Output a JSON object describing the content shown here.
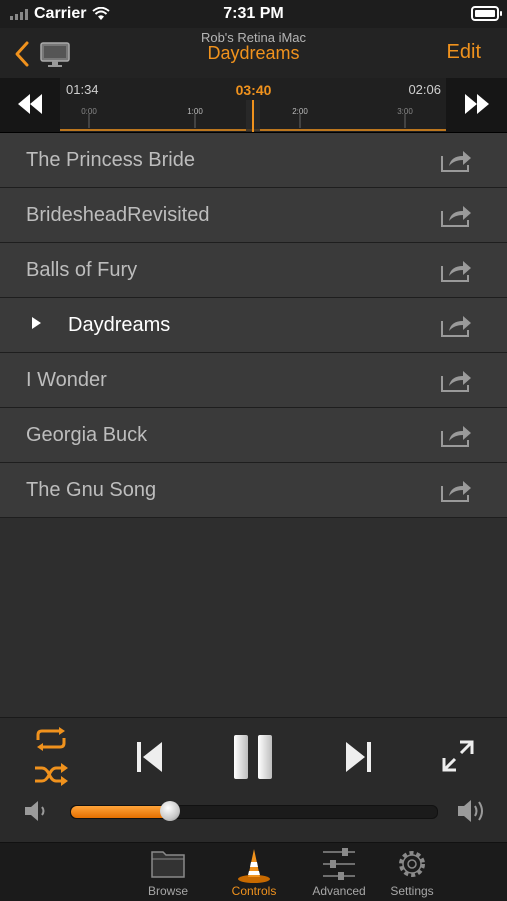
{
  "status_bar": {
    "carrier": "Carrier",
    "time": "7:31 PM"
  },
  "nav": {
    "subtitle": "Rob's Retina iMac",
    "title": "Daydreams",
    "edit_label": "Edit"
  },
  "scrubber": {
    "elapsed": "01:34",
    "current": "03:40",
    "remaining": "02:06",
    "ticks": [
      "0:00",
      "1:00",
      "2:00",
      "3:00"
    ]
  },
  "playlist": [
    {
      "title": "The Princess Bride",
      "playing": false
    },
    {
      "title": "BridesheadRevisited",
      "playing": false
    },
    {
      "title": "Balls of Fury",
      "playing": false
    },
    {
      "title": "Daydreams",
      "playing": true
    },
    {
      "title": "I Wonder",
      "playing": false
    },
    {
      "title": "Georgia Buck",
      "playing": false
    },
    {
      "title": "The Gnu Song",
      "playing": false
    }
  ],
  "volume": {
    "level": 0.27
  },
  "tabs": [
    {
      "label": "Browse",
      "active": false
    },
    {
      "label": "Controls",
      "active": true
    },
    {
      "label": "Advanced",
      "active": false
    },
    {
      "label": "Settings",
      "active": false
    }
  ],
  "colors": {
    "accent": "#f0921d",
    "background": "#2e2e2e",
    "row": "#3a3a3a"
  },
  "icons": [
    "back-icon",
    "monitor-icon",
    "rewind-icon",
    "fast-forward-icon",
    "share-icon",
    "repeat-icon",
    "shuffle-icon",
    "previous-icon",
    "pause-icon",
    "next-icon",
    "fullscreen-icon",
    "volume-low-icon",
    "volume-high-icon",
    "folder-icon",
    "cone-icon",
    "sliders-icon",
    "gear-icon"
  ]
}
